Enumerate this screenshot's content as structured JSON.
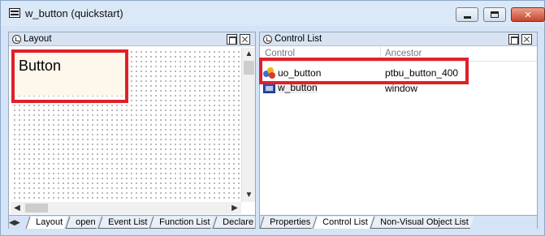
{
  "window": {
    "title": "w_button (quickstart)"
  },
  "layout_pane": {
    "title": "Layout",
    "control_label": "Button"
  },
  "layout_tabs": [
    "Layout",
    "open",
    "Event List",
    "Function List",
    "Declare Instar"
  ],
  "control_list_pane": {
    "title": "Control List",
    "columns": [
      "Control",
      "Ancestor"
    ],
    "rows": [
      {
        "control": "uo_button",
        "ancestor": "ptbu_button_400",
        "icon": "user-object-icon"
      },
      {
        "control": "w_button",
        "ancestor": "window",
        "icon": "window-icon"
      }
    ]
  },
  "control_list_tabs": [
    "Properties",
    "Control List",
    "Non-Visual Object List"
  ],
  "colors": {
    "highlight": "#e0202a",
    "control_bg": "#fdf7ec",
    "chrome": "#d4e4f6"
  }
}
